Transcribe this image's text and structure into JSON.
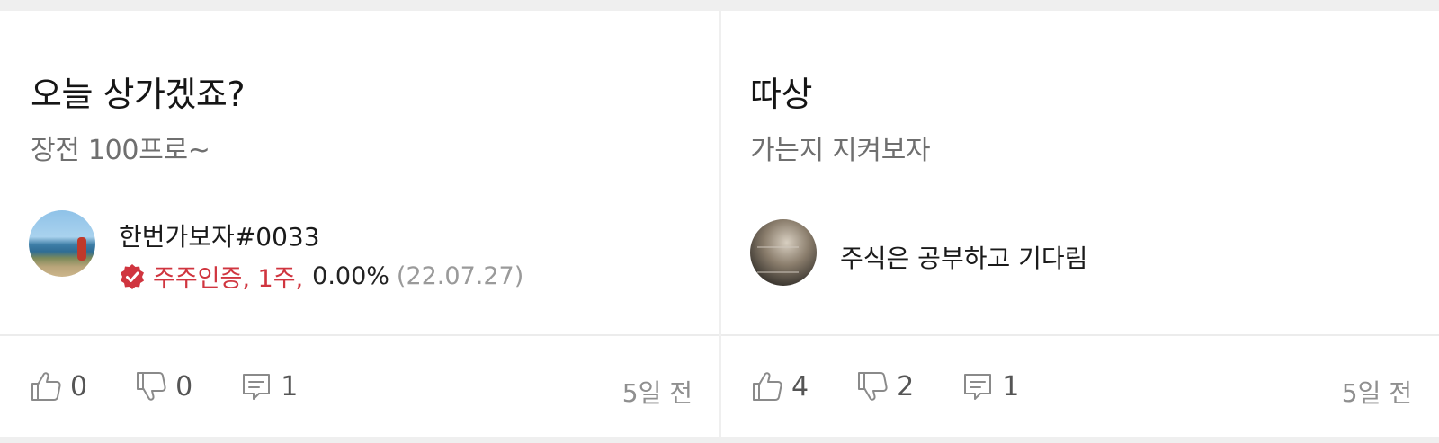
{
  "posts": [
    {
      "title": "오늘 상가겠죠?",
      "body": "장전 100프로~",
      "author": {
        "name": "한번가보자#0033",
        "badge": "주주인증, 1주,",
        "ratio": "0.00%",
        "date": "(22.07.27)"
      },
      "likes": "0",
      "dislikes": "0",
      "comments": "1",
      "time": "5일 전"
    },
    {
      "title": "따상",
      "body": "가는지 지켜보자",
      "author": {
        "name": "주식은 공부하고 기다림"
      },
      "likes": "4",
      "dislikes": "2",
      "comments": "1",
      "time": "5일 전"
    }
  ],
  "colors": {
    "badge_red": "#d0353f",
    "icon_gray": "#8a8a8a",
    "background": "#efefef"
  },
  "icons": [
    "thumbs-up-icon",
    "thumbs-down-icon",
    "comment-icon",
    "verified-badge-icon"
  ]
}
